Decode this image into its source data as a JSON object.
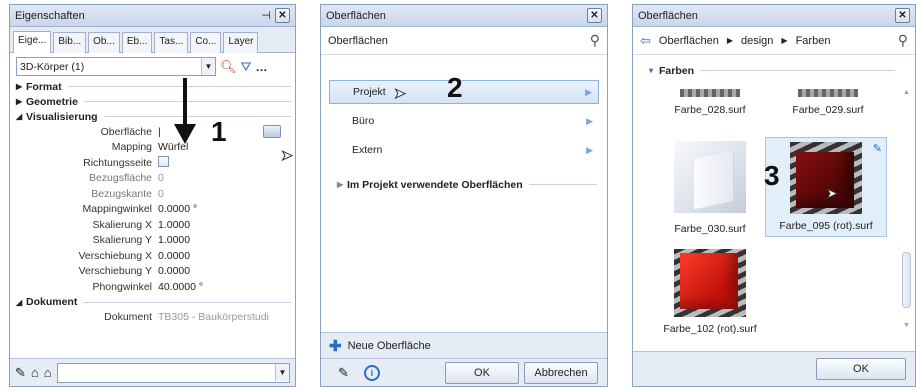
{
  "panel1": {
    "title": "Eigenschaften",
    "tabs": [
      "Eige...",
      "Bib...",
      "Ob...",
      "Eb...",
      "Tas...",
      "Co...",
      "Layer"
    ],
    "object_select": "3D-Körper (1)",
    "sections": {
      "format": "Format",
      "geometrie": "Geometrie",
      "visualisierung": "Visualisierung",
      "dokument": "Dokument"
    },
    "props": [
      {
        "k": "Oberfläche",
        "v": "|"
      },
      {
        "k": "Mapping",
        "v": "Würfel"
      },
      {
        "k": "Richtungsseite",
        "v": ""
      },
      {
        "k": "Bezugsfläche",
        "v": "0"
      },
      {
        "k": "Bezugskante",
        "v": "0"
      },
      {
        "k": "Mappingwinkel",
        "v": "0.0000 °"
      },
      {
        "k": "Skalierung X",
        "v": "1.0000"
      },
      {
        "k": "Skalierung Y",
        "v": "1.0000"
      },
      {
        "k": "Verschiebung X",
        "v": "0.0000"
      },
      {
        "k": "Verschiebung Y",
        "v": "0.0000"
      },
      {
        "k": "Phongwinkel",
        "v": "40.0000 °"
      }
    ],
    "dokument": {
      "k": "Dokument",
      "v": "TB305 - Baukörperstudi"
    }
  },
  "panel2": {
    "title": "Oberflächen",
    "header": "Oberflächen",
    "items": [
      "Projekt",
      "Büro",
      "Extern"
    ],
    "used_section": "Im Projekt verwendete Oberflächen",
    "new_surface": "Neue Oberfläche",
    "ok": "OK",
    "cancel": "Abbrechen"
  },
  "panel3": {
    "title": "Oberflächen",
    "breadcrumb": [
      "Oberflächen",
      "design",
      "Farben"
    ],
    "group": "Farben",
    "tiles": [
      "Farbe_028.surf",
      "Farbe_029.surf",
      "Farbe_030.surf",
      "Farbe_095 (rot).surf",
      "Farbe_102 (rot).surf"
    ],
    "ok": "OK"
  },
  "annotations": [
    "1",
    "2",
    "3"
  ]
}
